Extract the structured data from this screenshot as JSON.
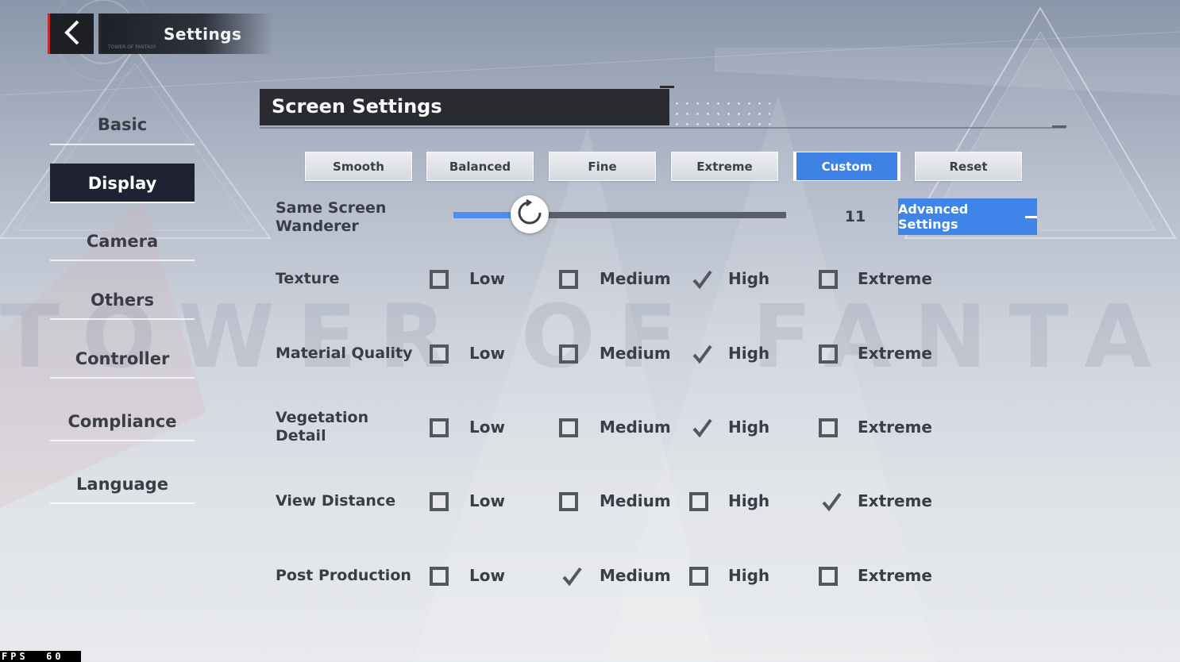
{
  "header": {
    "title": "Settings",
    "subtitle": "TOWER OF FANTASY"
  },
  "background": {
    "watermark": "TOWER OF FANTASY"
  },
  "sidebar": {
    "items": [
      {
        "label": "Basic",
        "active": false
      },
      {
        "label": "Display",
        "active": true
      },
      {
        "label": "Camera",
        "active": false
      },
      {
        "label": "Others",
        "active": false
      },
      {
        "label": "Controller",
        "active": false
      },
      {
        "label": "Compliance",
        "active": false
      },
      {
        "label": "Language",
        "active": false
      }
    ]
  },
  "section": {
    "title": "Screen Settings"
  },
  "presets": [
    {
      "label": "Smooth",
      "active": false
    },
    {
      "label": "Balanced",
      "active": false
    },
    {
      "label": "Fine",
      "active": false
    },
    {
      "label": "Extreme",
      "active": false
    },
    {
      "label": "Custom",
      "active": true
    },
    {
      "label": "Reset",
      "active": false
    }
  ],
  "wanderer": {
    "label_line1": "Same Screen",
    "label_line2": "Wanderer",
    "value": "11",
    "fill_fraction": 0.23,
    "advanced_label": "Advanced Settings"
  },
  "option_levels": [
    "Low",
    "Medium",
    "High",
    "Extreme"
  ],
  "options": [
    {
      "label_line1": "Texture",
      "label_line2": "",
      "selected": "High"
    },
    {
      "label_line1": "Material Quality",
      "label_line2": "",
      "selected": "High"
    },
    {
      "label_line1": "Vegetation",
      "label_line2": "Detail",
      "selected": "High"
    },
    {
      "label_line1": "View Distance",
      "label_line2": "",
      "selected": "Extreme"
    },
    {
      "label_line1": "Post Production",
      "label_line2": "",
      "selected": "Medium"
    }
  ],
  "fps": {
    "text": "FPS  60"
  },
  "colors": {
    "accent": "#3f84e8",
    "panel_dark": "#2a2b30",
    "back_accent": "#c52a2a"
  }
}
